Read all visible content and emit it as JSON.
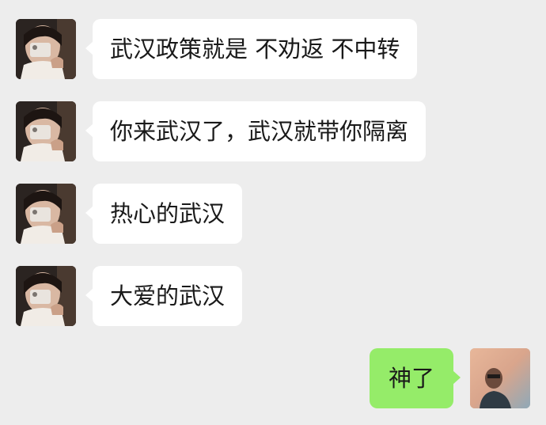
{
  "chat": {
    "messages": [
      {
        "sender": "contact",
        "text": "武汉政策就是 不劝返 不中转"
      },
      {
        "sender": "contact",
        "text": "你来武汉了，武汉就带你隔离"
      },
      {
        "sender": "contact",
        "text": "热心的武汉"
      },
      {
        "sender": "contact",
        "text": "大爱的武汉"
      },
      {
        "sender": "me",
        "text": "神了"
      }
    ]
  },
  "colors": {
    "background": "#ededed",
    "incoming_bubble": "#ffffff",
    "outgoing_bubble": "#95ec69",
    "text": "#191919"
  }
}
